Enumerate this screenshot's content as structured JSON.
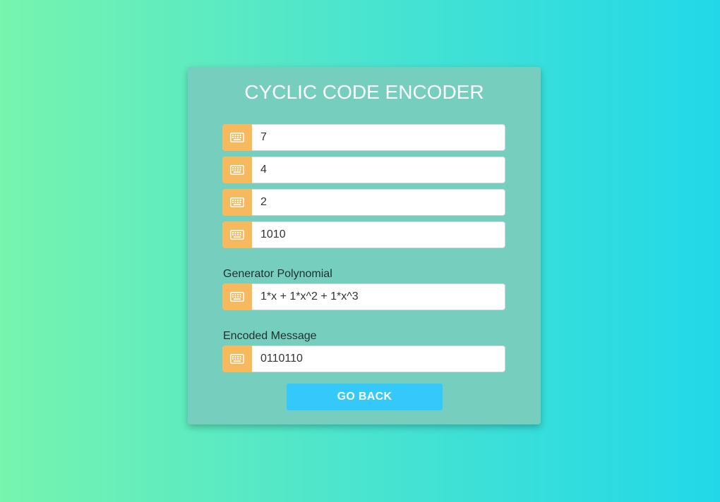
{
  "title": "CYCLIC CODE ENCODER",
  "icons": {
    "input_addon": "keyboard-icon"
  },
  "colors": {
    "card": "#76cfbe",
    "addon": "#f7b95d",
    "button": "#34c8fb",
    "gradient_start": "#77f4ae",
    "gradient_end": "#22d8e8"
  },
  "fields": {
    "n": {
      "value": "7"
    },
    "k": {
      "value": "4"
    },
    "base": {
      "value": "2"
    },
    "message": {
      "value": "1010"
    }
  },
  "generator": {
    "label": "Generator Polynomial",
    "value": "1*x + 1*x^2 + 1*x^3"
  },
  "encoded": {
    "label": "Encoded Message",
    "value": "0110110"
  },
  "actions": {
    "back_label": "GO BACK"
  }
}
